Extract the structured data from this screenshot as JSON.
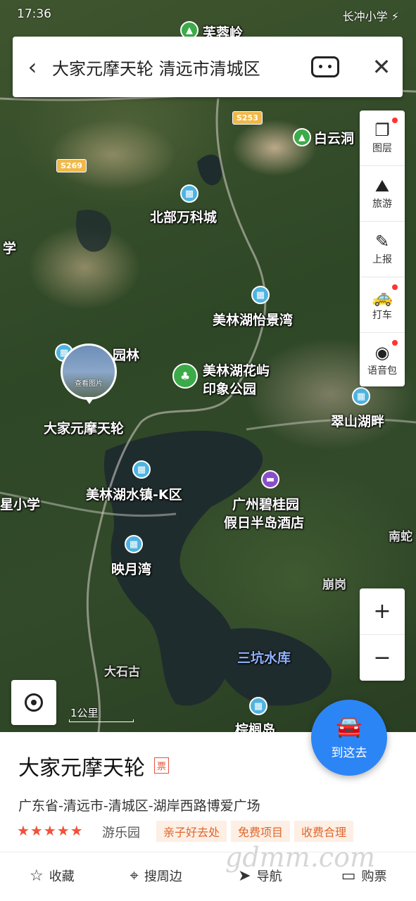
{
  "status_bar": {
    "time": "17:36",
    "right": "长冲小学 ⚡"
  },
  "search": {
    "query": "大家元摩天轮 清远市清城区"
  },
  "toolbar": {
    "items": [
      {
        "label": "图层",
        "icon": "layers-icon",
        "glyph": "❐",
        "dot": true
      },
      {
        "label": "旅游",
        "icon": "travel-icon",
        "glyph": "⛰",
        "dot": false
      },
      {
        "label": "上报",
        "icon": "report-icon",
        "glyph": "✎",
        "dot": false
      },
      {
        "label": "打车",
        "icon": "taxi-icon",
        "glyph": "🚕",
        "dot": true
      },
      {
        "label": "语音包",
        "icon": "voice-pack-icon",
        "glyph": "◉",
        "dot": true
      }
    ]
  },
  "map": {
    "labels": {
      "furongling": "芙蓉岭",
      "baiyundong": "白云洞",
      "beibu": "北部万科城",
      "xue": "学",
      "meilin_yijing": "美林湖怡景湾",
      "yuanlin": "园林",
      "huaxu_1": "美林湖花屿",
      "huaxu_2": "印象公园",
      "cuishan": "翠山湖畔",
      "target": "大家元摩天轮",
      "kqu": "美林湖水镇-K区",
      "hotel_1": "广州碧桂园",
      "hotel_2": "假日半岛酒店",
      "xingxiao": "星小学",
      "nan": "南蛇",
      "yingyue": "映月湾",
      "benggang": "崩岗",
      "dashigu": "大石古",
      "sankeng": "三坑水库",
      "zonglv": "棕榈岛",
      "s253": "S253",
      "s269": "S269",
      "scale": "1公里",
      "photo": "查看图片"
    }
  },
  "zoom": {
    "in": "+",
    "out": "−"
  },
  "go": {
    "label": "到这去"
  },
  "place": {
    "name": "大家元摩天轮",
    "ticket": "票",
    "address": "广东省-清远市-清城区-湖岸西路博爱广场",
    "stars": "★★★★★",
    "rating": 5,
    "category": "游乐园",
    "tags": [
      "亲子好去处",
      "免费项目",
      "收费合理"
    ]
  },
  "actions": [
    {
      "label": "收藏",
      "glyph": "☆",
      "icon": "star-icon"
    },
    {
      "label": "搜周边",
      "glyph": "⌖",
      "icon": "nearby-pin-icon"
    },
    {
      "label": "导航",
      "glyph": "➤",
      "icon": "navigate-icon"
    },
    {
      "label": "购票",
      "glyph": "▭",
      "icon": "ticket-icon"
    }
  ],
  "watermark": "gdmm.com"
}
